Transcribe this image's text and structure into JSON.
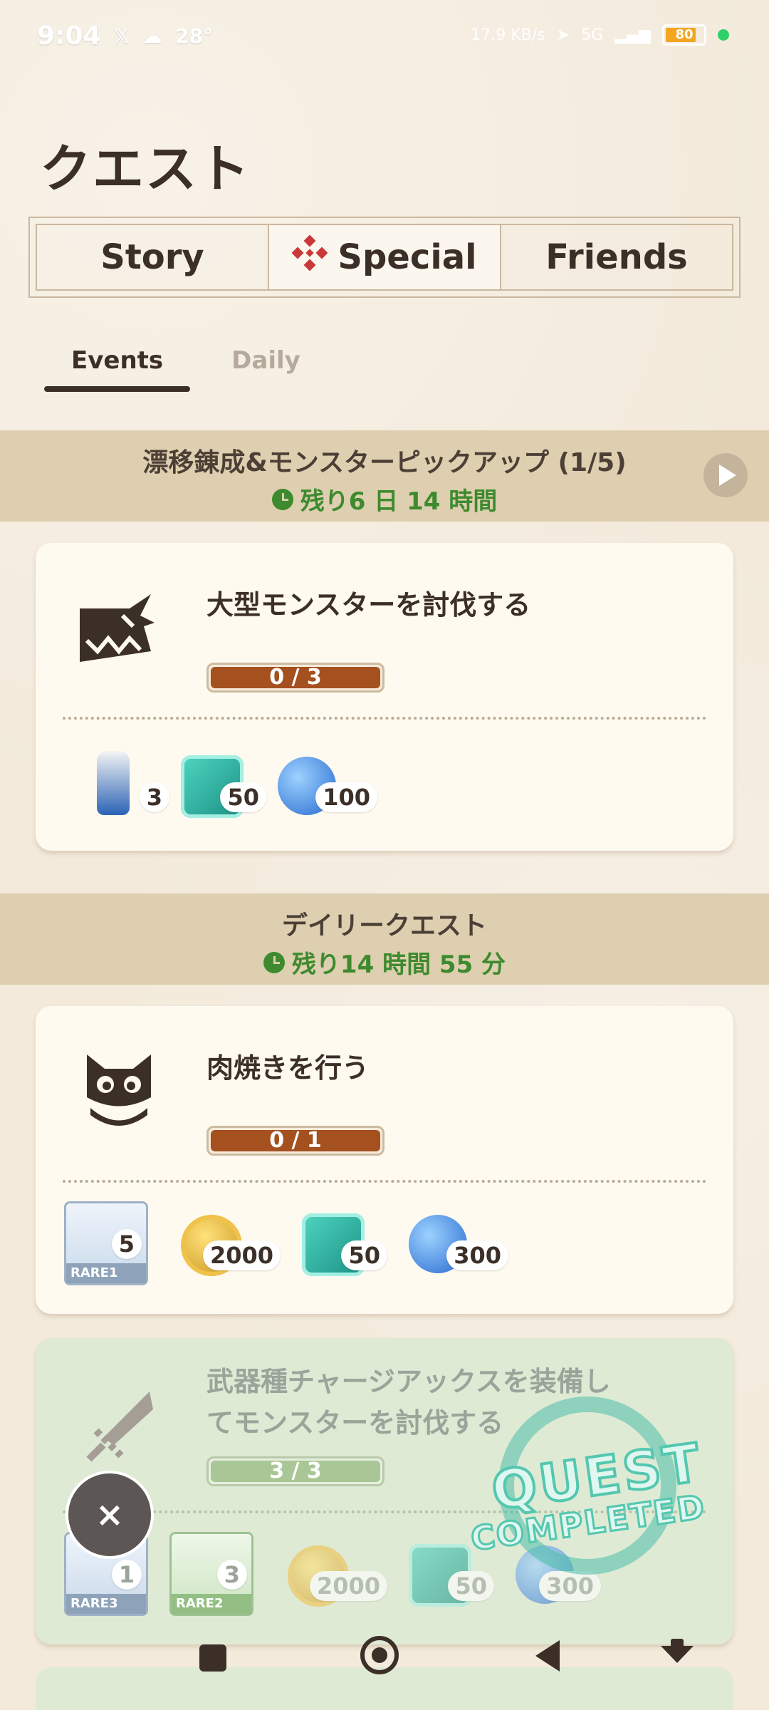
{
  "status_bar": {
    "time": "9:04",
    "temperature": "28°",
    "net_speed": "17.9 KB/s",
    "battery": "80",
    "network": "5G"
  },
  "title": "クエスト",
  "segments": [
    {
      "label": "Story",
      "active": false
    },
    {
      "label": "Special",
      "active": true
    },
    {
      "label": "Friends",
      "active": false
    }
  ],
  "subtabs": [
    {
      "label": "Events",
      "active": true
    },
    {
      "label": "Daily",
      "active": false
    }
  ],
  "sections": [
    {
      "title": "漂移錬成&モンスターピックアップ (1/5)",
      "timer": "残り6 日 14 時間",
      "quests": [
        {
          "title": "大型モンスターを討伐する",
          "icon": "monster-icon",
          "progress_label": "0 / 3",
          "progress_fraction": 0,
          "rewards": [
            {
              "icon": "potion-icon",
              "count": "3"
            },
            {
              "icon": "teal-gem-icon",
              "count": "50"
            },
            {
              "icon": "blue-coin-icon",
              "count": "100"
            }
          ]
        }
      ]
    },
    {
      "title": "デイリークエスト",
      "timer": "残り14 時間 55 分",
      "quests": [
        {
          "title": "肉焼きを行う",
          "icon": "palico-icon",
          "progress_label": "0 / 1",
          "progress_fraction": 0,
          "rewards": [
            {
              "icon": "bone-material-icon",
              "count": "5",
              "rarity": "RARE1"
            },
            {
              "icon": "gold-coin-icon",
              "count": "2000"
            },
            {
              "icon": "teal-gem-icon",
              "count": "50"
            },
            {
              "icon": "blue-coin-icon",
              "count": "300"
            }
          ]
        },
        {
          "title": "武器種チャージアックスを装備してモンスターを討伐する",
          "title_line1": "武器種チャージアックスを装備し",
          "title_line2": "てモンスターを討伐する",
          "icon": "sword-icon",
          "progress_label": "3 / 3",
          "progress_fraction": 1,
          "completed": true,
          "stamp_line1": "QUEST",
          "stamp_line2": "COMPLETED",
          "rewards": [
            {
              "icon": "armor-material-icon",
              "count": "1",
              "rarity": "RARE3"
            },
            {
              "icon": "tank-material-icon",
              "count": "3",
              "rarity": "RARE2"
            },
            {
              "icon": "gold-coin-icon",
              "count": "2000"
            },
            {
              "icon": "teal-gem-icon",
              "count": "50"
            },
            {
              "icon": "blue-coin-icon",
              "count": "300"
            }
          ]
        }
      ]
    }
  ],
  "fab_close_label": "×",
  "colors": {
    "background": "#f3eadb",
    "section_header": "#ddcfaf",
    "progress_fill": "#a5501f",
    "timer_green": "#3e8a2e",
    "completed_card": "#dfead5"
  }
}
